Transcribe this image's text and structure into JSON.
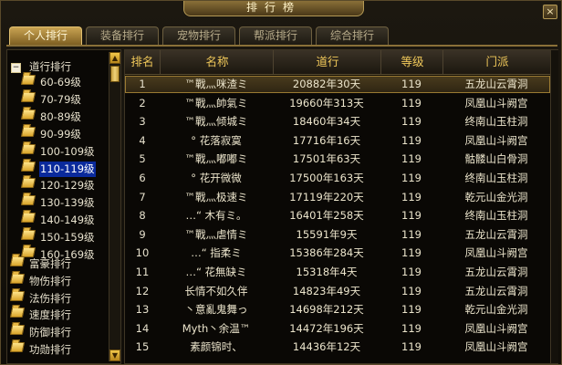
{
  "window": {
    "title": "排行榜",
    "close_label": "×"
  },
  "tabs": [
    {
      "label": "个人排行",
      "active": true
    },
    {
      "label": "装备排行",
      "active": false
    },
    {
      "label": "宠物排行",
      "active": false
    },
    {
      "label": "帮派排行",
      "active": false
    },
    {
      "label": "综合排行",
      "active": false
    }
  ],
  "tree": {
    "group_expander": "−",
    "group_label": "道行排行",
    "sub_items": [
      "60-69级",
      "70-79级",
      "80-89级",
      "90-99级",
      "100-109级",
      "110-119级",
      "120-129级",
      "130-139级",
      "140-149级",
      "150-159级",
      "160-169级"
    ],
    "selected": "110-119级",
    "top_items": [
      "富豪排行",
      "物伤排行",
      "法伤排行",
      "速度排行",
      "防御排行",
      "功勋排行"
    ]
  },
  "scroll": {
    "up_label": "▲",
    "down_label": "▼"
  },
  "table": {
    "headers": [
      "排名",
      "名称",
      "道行",
      "等级",
      "门派"
    ],
    "rows": [
      [
        "1",
        "™戰灬咪渣ミ",
        "20882年30天",
        "119",
        "五龙山云霄洞"
      ],
      [
        "2",
        "™戰灬帥氣ミ",
        "19660年313天",
        "119",
        "凤凰山斗阙宫"
      ],
      [
        "3",
        "™戰灬倾城ミ",
        "18460年34天",
        "119",
        "终南山玉柱洞"
      ],
      [
        "4",
        "° 花落寂寞",
        "17716年16天",
        "119",
        "凤凰山斗阙宫"
      ],
      [
        "5",
        "™戰灬嘟嘟ミ",
        "17501年63天",
        "119",
        "骷髅山白骨洞"
      ],
      [
        "6",
        "° 花开微微",
        "17500年163天",
        "119",
        "终南山玉柱洞"
      ],
      [
        "7",
        "™戰灬极速ミ",
        "17119年220天",
        "119",
        "乾元山金光洞"
      ],
      [
        "8",
        "…“ 木有ミ。",
        "16401年258天",
        "119",
        "终南山玉柱洞"
      ],
      [
        "9",
        "™戰灬虐情ミ",
        "15591年9天",
        "119",
        "五龙山云霄洞"
      ],
      [
        "10",
        "…“ 指柔ミ",
        "15386年284天",
        "119",
        "凤凰山斗阙宫"
      ],
      [
        "11",
        "…“ 花無缺ミ",
        "15318年4天",
        "119",
        "五龙山云霄洞"
      ],
      [
        "12",
        "长情不如久伴",
        "14823年49天",
        "119",
        "五龙山云霄洞"
      ],
      [
        "13",
        "丶意亂鬼舞っ",
        "14698年212天",
        "119",
        "乾元山金光洞"
      ],
      [
        "14",
        "Myth丶余温™",
        "14472年196天",
        "119",
        "凤凰山斗阙宫"
      ],
      [
        "15",
        "素颜锦时、",
        "14436年12天",
        "119",
        "凤凰山斗阙宫"
      ]
    ],
    "highlight_row": 0
  }
}
